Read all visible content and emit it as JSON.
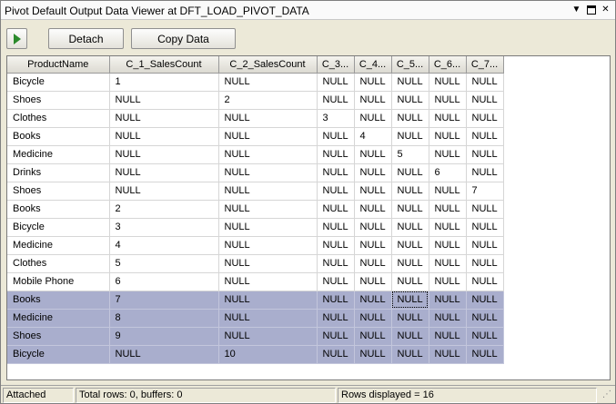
{
  "window": {
    "title": "Pivot Default Output Data Viewer at DFT_LOAD_PIVOT_DATA"
  },
  "toolbar": {
    "play_icon": "play-icon",
    "detach_label": "Detach",
    "copy_label": "Copy Data"
  },
  "grid": {
    "columns": [
      "ProductName",
      "C_1_SalesCount",
      "C_2_SalesCount",
      "C_3...",
      "C_4...",
      "C_5...",
      "C_6...",
      "C_7..."
    ],
    "rows": [
      [
        "Bicycle",
        "1",
        "NULL",
        "NULL",
        "NULL",
        "NULL",
        "NULL",
        "NULL"
      ],
      [
        "Shoes",
        "NULL",
        "2",
        "NULL",
        "NULL",
        "NULL",
        "NULL",
        "NULL"
      ],
      [
        "Clothes",
        "NULL",
        "NULL",
        "3",
        "NULL",
        "NULL",
        "NULL",
        "NULL"
      ],
      [
        "Books",
        "NULL",
        "NULL",
        "NULL",
        "4",
        "NULL",
        "NULL",
        "NULL"
      ],
      [
        "Medicine",
        "NULL",
        "NULL",
        "NULL",
        "NULL",
        "5",
        "NULL",
        "NULL"
      ],
      [
        "Drinks",
        "NULL",
        "NULL",
        "NULL",
        "NULL",
        "NULL",
        "6",
        "NULL"
      ],
      [
        "Shoes",
        "NULL",
        "NULL",
        "NULL",
        "NULL",
        "NULL",
        "NULL",
        "7"
      ],
      [
        "Books",
        "2",
        "NULL",
        "NULL",
        "NULL",
        "NULL",
        "NULL",
        "NULL"
      ],
      [
        "Bicycle",
        "3",
        "NULL",
        "NULL",
        "NULL",
        "NULL",
        "NULL",
        "NULL"
      ],
      [
        "Medicine",
        "4",
        "NULL",
        "NULL",
        "NULL",
        "NULL",
        "NULL",
        "NULL"
      ],
      [
        "Clothes",
        "5",
        "NULL",
        "NULL",
        "NULL",
        "NULL",
        "NULL",
        "NULL"
      ],
      [
        "Mobile Phone",
        "6",
        "NULL",
        "NULL",
        "NULL",
        "NULL",
        "NULL",
        "NULL"
      ],
      [
        "Books",
        "7",
        "NULL",
        "NULL",
        "NULL",
        "NULL",
        "NULL",
        "NULL"
      ],
      [
        "Medicine",
        "8",
        "NULL",
        "NULL",
        "NULL",
        "NULL",
        "NULL",
        "NULL"
      ],
      [
        "Shoes",
        "9",
        "NULL",
        "NULL",
        "NULL",
        "NULL",
        "NULL",
        "NULL"
      ],
      [
        "Bicycle",
        "NULL",
        "10",
        "NULL",
        "NULL",
        "NULL",
        "NULL",
        "NULL"
      ]
    ],
    "selected_rows": [
      12,
      13,
      14,
      15
    ],
    "focused_cell": {
      "row": 12,
      "col": 5
    },
    "selection_color": "#a9aecd"
  },
  "status": {
    "state": "Attached",
    "totals": "Total rows: 0, buffers: 0",
    "rows_displayed": "Rows displayed = 16"
  }
}
